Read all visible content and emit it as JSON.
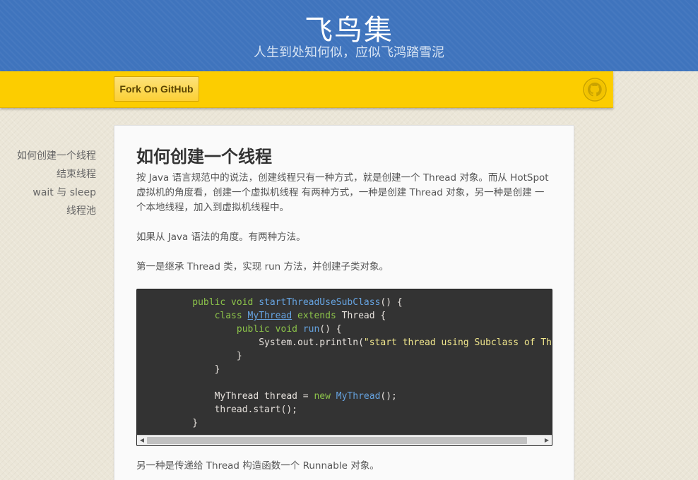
{
  "header": {
    "title": "飞鸟集",
    "subtitle": "人生到处知何似，应似飞鸿踏雪泥"
  },
  "toolbar": {
    "fork_label": "Fork On GitHub",
    "github_icon": "github-octocat-icon"
  },
  "toc": {
    "items": [
      {
        "label": "如何创建一个线程"
      },
      {
        "label": "结束线程"
      },
      {
        "label": "wait 与 sleep"
      },
      {
        "label": "线程池"
      }
    ]
  },
  "article": {
    "title": "如何创建一个线程",
    "p1": "按 Java 语言规范中的说法，创建线程只有一种方式，就是创建一个 Thread 对象。而从 HotSpot 虚拟机的角度看，创建一个虚拟机线程 有两种方式，一种是创建 Thread 对象，另一种是创建 一个本地线程，加入到虚拟机线程中。",
    "p2": "如果从 Java 语法的角度。有两种方法。",
    "p3": "第一是继承 Thread 类，实现 run 方法，并创建子类对象。",
    "p4": "另一种是传递给 Thread 构造函数一个 Runnable 对象。"
  },
  "code": {
    "lines": [
      [
        {
          "t": "    public void ",
          "c": "kw"
        },
        {
          "t": "startThreadUseSubClass",
          "c": "fn"
        },
        {
          "t": "() {",
          "c": ""
        }
      ],
      [
        {
          "t": "        class ",
          "c": "kw"
        },
        {
          "t": "MyThread",
          "c": "cls"
        },
        {
          "t": " extends ",
          "c": "kw"
        },
        {
          "t": "Thread {",
          "c": ""
        }
      ],
      [
        {
          "t": "            public void ",
          "c": "kw"
        },
        {
          "t": "run",
          "c": "fn"
        },
        {
          "t": "() {",
          "c": ""
        }
      ],
      [
        {
          "t": "                System.out.println(",
          "c": ""
        },
        {
          "t": "\"start thread using Subclass of Thread\"",
          "c": "str"
        },
        {
          "t": ");",
          "c": ""
        }
      ],
      [
        {
          "t": "            }",
          "c": ""
        }
      ],
      [
        {
          "t": "        }",
          "c": ""
        }
      ],
      [
        {
          "t": "",
          "c": ""
        }
      ],
      [
        {
          "t": "        MyThread thread = ",
          "c": ""
        },
        {
          "t": "new ",
          "c": "kw"
        },
        {
          "t": "MyThread",
          "c": "fn"
        },
        {
          "t": "();",
          "c": ""
        }
      ],
      [
        {
          "t": "        thread.start();",
          "c": ""
        }
      ],
      [
        {
          "t": "    }",
          "c": ""
        }
      ]
    ]
  },
  "colors": {
    "header_bg": "#3f74bd",
    "toolbar_bg": "#fccd00",
    "code_bg": "#333333"
  }
}
